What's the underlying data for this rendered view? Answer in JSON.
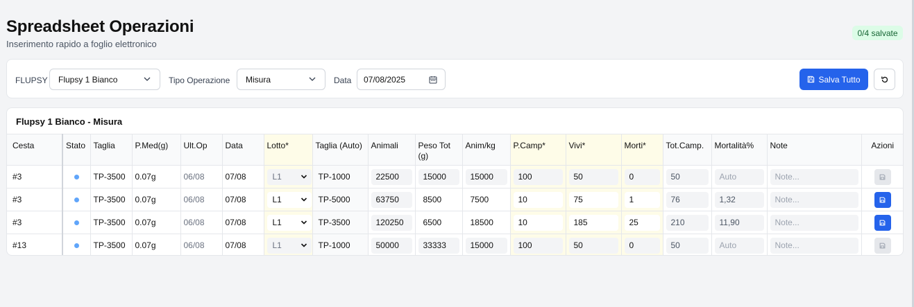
{
  "header": {
    "title": "Spreadsheet Operazioni",
    "subtitle": "Inserimento rapido a foglio elettronico",
    "badge": "0/4 salvate"
  },
  "toolbar": {
    "flupsy_label": "FLUPSY",
    "flupsy_value": "Flupsy 1 Bianco",
    "tipo_label": "Tipo Operazione",
    "tipo_value": "Misura",
    "data_label": "Data",
    "data_value": "07/08/2025",
    "save_all_label": "Salva Tutto",
    "icons": {
      "save": "save-icon",
      "refresh": "refresh-icon",
      "calendar": "calendar-icon",
      "dropdown": "chevron-down-icon"
    }
  },
  "table": {
    "title": "Flupsy 1 Bianco - Misura",
    "headers": {
      "cesta": "Cesta",
      "stato": "Stato",
      "taglia": "Taglia",
      "pmed": "P.Med(g)",
      "ultop": "Ult.Op",
      "data": "Data",
      "lotto": "Lotto*",
      "taglia_auto": "Taglia (Auto)",
      "animali": "Animali",
      "peso_tot": "Peso Tot (g)",
      "anim_kg": "Anim/kg",
      "pcamp": "P.Camp*",
      "vivi": "Vivi*",
      "morti": "Morti*",
      "tot_camp": "Tot.Camp.",
      "mortalita": "Mortalità%",
      "note": "Note",
      "azioni": "Azioni"
    },
    "rows": [
      {
        "cesta": "#3",
        "taglia": "TP-3500",
        "pmed": "0.07g",
        "ultop": "06/08",
        "data": "07/08",
        "lotto": "L1",
        "taglia_auto": "TP-1000",
        "animali": "22500",
        "peso_tot": "15000",
        "anim_kg": "15000",
        "pcamp": "100",
        "vivi": "50",
        "morti": "0",
        "tot_camp": "50",
        "mortalita": "Auto",
        "note": "Note...",
        "editable": false
      },
      {
        "cesta": "#3",
        "taglia": "TP-3500",
        "pmed": "0.07g",
        "ultop": "06/08",
        "data": "07/08",
        "lotto": "L1",
        "taglia_auto": "TP-5000",
        "animali": "63750",
        "peso_tot": "8500",
        "anim_kg": "7500",
        "pcamp": "10",
        "vivi": "75",
        "morti": "1",
        "tot_camp": "76",
        "mortalita": "1,32",
        "note": "Note...",
        "editable": true
      },
      {
        "cesta": "#3",
        "taglia": "TP-3500",
        "pmed": "0.07g",
        "ultop": "06/08",
        "data": "07/08",
        "lotto": "L1",
        "taglia_auto": "TP-3500",
        "animali": "120250",
        "peso_tot": "6500",
        "anim_kg": "18500",
        "pcamp": "10",
        "vivi": "185",
        "morti": "25",
        "tot_camp": "210",
        "mortalita": "11,90",
        "note": "Note...",
        "editable": true
      },
      {
        "cesta": "#13",
        "taglia": "TP-3500",
        "pmed": "0.07g",
        "ultop": "06/08",
        "data": "07/08",
        "lotto": "L1",
        "taglia_auto": "TP-1000",
        "animali": "50000",
        "peso_tot": "33333",
        "anim_kg": "15000",
        "pcamp": "100",
        "vivi": "50",
        "morti": "0",
        "tot_camp": "50",
        "mortalita": "Auto",
        "note": "Note...",
        "editable": false
      }
    ]
  },
  "colors": {
    "primary": "#2563eb",
    "status_dot": "#60a5fa",
    "highlight_col": "#fefce8",
    "badge_bg": "#dcfce7"
  }
}
